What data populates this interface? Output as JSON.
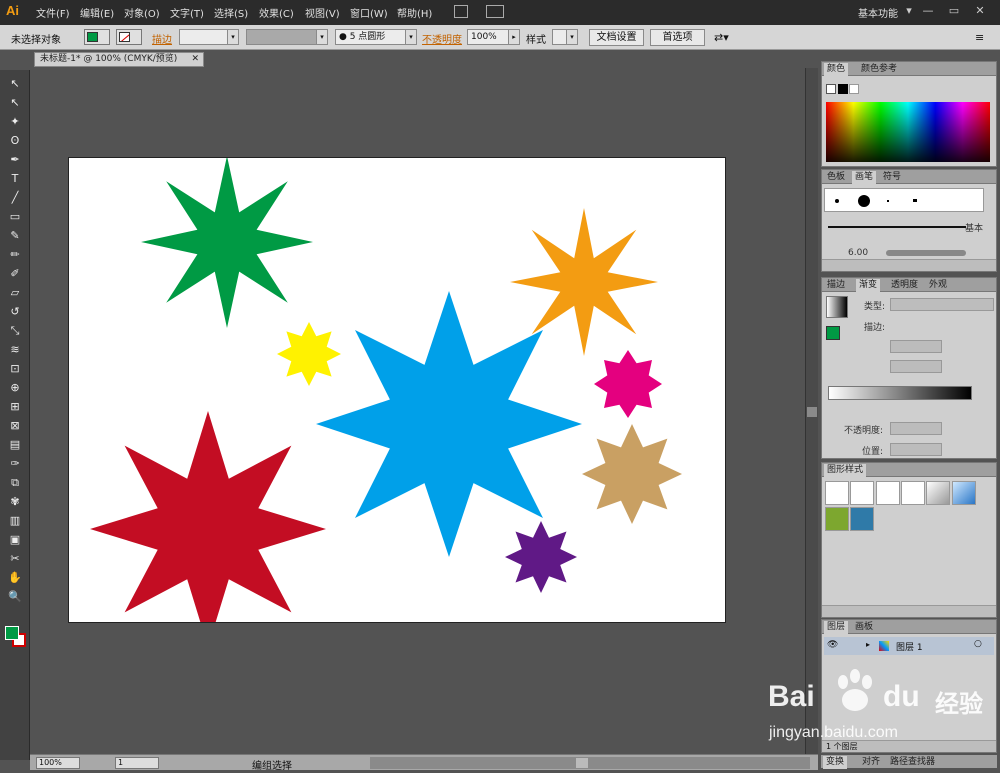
{
  "app": {
    "logo": "Ai"
  },
  "menu": [
    "文件(F)",
    "编辑(E)",
    "对象(O)",
    "文字(T)",
    "选择(S)",
    "效果(C)",
    "视图(V)",
    "窗口(W)",
    "帮助(H)"
  ],
  "workspace": "基本功能",
  "window_buttons": [
    "▾",
    "—",
    "▭",
    "✕"
  ],
  "control": {
    "selection_status": "未选择对象",
    "stroke_label": "描边",
    "brush_value": "● 5 点圆形",
    "opacity_label": "不透明度",
    "opacity_value": "100%",
    "style_label": "样式",
    "doc_settings": "文档设置",
    "preferences": "首选项"
  },
  "document": {
    "tab_title": "未标题-1* @ 100% (CMYK/预览)",
    "tab_close": "✕"
  },
  "status": {
    "zoom": "100%",
    "page": "1",
    "tool_status": "编组选择"
  },
  "panels": {
    "color": {
      "tabs": [
        "颜色",
        "颜色参考"
      ]
    },
    "brushes": {
      "tabs": [
        "色板",
        "画笔",
        "符号"
      ],
      "basic_label": "基本",
      "size_label": "6.00"
    },
    "gradient": {
      "tabs": [
        "描边",
        "渐变",
        "透明度",
        "外观"
      ],
      "type_label": "类型:",
      "stroke_label": "描边:",
      "opacity_label": "不透明度:",
      "location_label": "位置:"
    },
    "graphic_styles": {
      "tabs": [
        "图形样式"
      ]
    },
    "layers": {
      "tabs": [
        "图层",
        "画板"
      ],
      "layer_name": "图层 1",
      "layer_count": "1 个图层"
    },
    "bottom": {
      "tabs": [
        "变换",
        "对齐",
        "路径查找器"
      ]
    }
  },
  "tools": [
    "selection-tool",
    "direct-selection-tool",
    "magic-wand-tool",
    "lasso-tool",
    "pen-tool",
    "type-tool",
    "line-tool",
    "rectangle-tool",
    "paintbrush-tool",
    "pencil-tool",
    "blob-brush-tool",
    "eraser-tool",
    "rotate-tool",
    "scale-tool",
    "warp-tool",
    "free-transform-tool",
    "shape-builder-tool",
    "perspective-grid-tool",
    "mesh-tool",
    "gradient-tool",
    "eyedropper-tool",
    "blend-tool",
    "symbol-sprayer-tool",
    "column-graph-tool",
    "artboard-tool",
    "slice-tool",
    "hand-tool",
    "zoom-tool"
  ],
  "tool_glyphs": [
    "↖",
    "↖",
    "✦",
    "ʘ",
    "✒",
    "T",
    "╱",
    "▭",
    "✎",
    "✏",
    "✐",
    "▱",
    "↺",
    "⤡",
    "≋",
    "⊡",
    "⊕",
    "⊞",
    "⊠",
    "▤",
    "✑",
    "⧉",
    "✾",
    "▥",
    "▣",
    "✂",
    "✋",
    "🔍"
  ],
  "stars": [
    {
      "color": "#009a44",
      "points": 8
    },
    {
      "color": "#f39c12",
      "points": 8
    },
    {
      "color": "#fff200",
      "points": 8
    },
    {
      "color": "#00a0e9",
      "points": 8
    },
    {
      "color": "#e4007f",
      "points": 8
    },
    {
      "color": "#c9a063",
      "points": 8
    },
    {
      "color": "#c30d23",
      "points": 8
    },
    {
      "color": "#601986",
      "points": 8
    }
  ],
  "watermark": {
    "brand": "Bai",
    "brand2": "du",
    "suffix": "经验",
    "url": "jingyan.baidu.com"
  },
  "colors": {
    "fill": "#009a44",
    "accent": "#f39c12"
  }
}
